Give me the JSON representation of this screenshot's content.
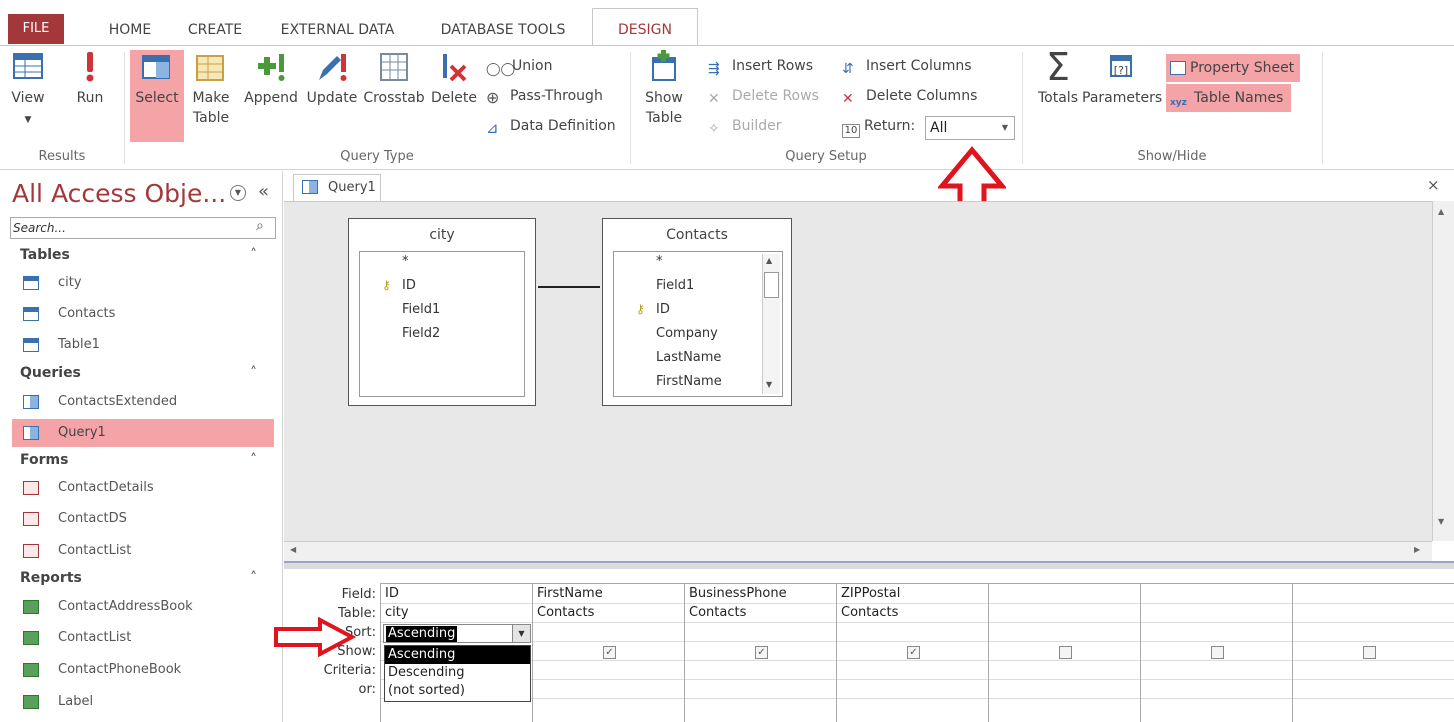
{
  "tabs": {
    "file": "FILE",
    "home": "HOME",
    "create": "CREATE",
    "external": "EXTERNAL DATA",
    "dbtools": "DATABASE TOOLS",
    "design": "DESIGN"
  },
  "ribbon": {
    "view": "View",
    "run": "Run",
    "select": "Select",
    "make_table_1": "Make",
    "make_table_2": "Table",
    "append": "Append",
    "update": "Update",
    "crosstab": "Crosstab",
    "delete": "Delete",
    "union": "Union",
    "passthrough": "Pass-Through",
    "data_definition": "Data Definition",
    "show_table_1": "Show",
    "show_table_2": "Table",
    "insert_rows": "Insert Rows",
    "delete_rows": "Delete Rows",
    "builder": "Builder",
    "insert_columns": "Insert Columns",
    "delete_columns": "Delete Columns",
    "return_label": "Return:",
    "return_value": "All",
    "totals": "Totals",
    "parameters": "Parameters",
    "property_sheet": "Property Sheet",
    "table_names": "Table Names",
    "groups": {
      "results": "Results",
      "query_type": "Query Type",
      "query_setup": "Query Setup",
      "show_hide": "Show/Hide"
    }
  },
  "nav": {
    "title": "All Access Obje...",
    "search_placeholder": "Search...",
    "sections": {
      "tables": "Tables",
      "queries": "Queries",
      "forms": "Forms",
      "reports": "Reports"
    },
    "tables": [
      "city",
      "Contacts",
      "Table1"
    ],
    "queries": [
      "ContactsExtended",
      "Query1"
    ],
    "forms": [
      "ContactDetails",
      "ContactDS",
      "ContactList"
    ],
    "reports": [
      "ContactAddressBook",
      "ContactList",
      "ContactPhoneBook",
      "Label"
    ]
  },
  "query_tab": "Query1",
  "tables": {
    "city": {
      "title": "city",
      "fields": [
        "*",
        "ID",
        "Field1",
        "Field2"
      ]
    },
    "contacts": {
      "title": "Contacts",
      "fields": [
        "*",
        "Field1",
        "ID",
        "Company",
        "LastName",
        "FirstName"
      ]
    }
  },
  "grid": {
    "row_labels": {
      "field": "Field:",
      "table": "Table:",
      "sort": "Sort:",
      "show": "Show:",
      "criteria": "Criteria:",
      "or": "or:"
    },
    "columns": [
      {
        "field": "ID",
        "table": "city",
        "sort": "Ascending"
      },
      {
        "field": "FirstName",
        "table": "Contacts",
        "show": true
      },
      {
        "field": "BusinessPhone",
        "table": "Contacts",
        "show": true
      },
      {
        "field": "ZIPPostal",
        "table": "Contacts",
        "show": true
      }
    ],
    "sort_options": [
      "Ascending",
      "Descending",
      "(not sorted)"
    ],
    "checkmark": "✓"
  },
  "colors": {
    "accent": "#a4373a",
    "highlight": "#f4a3a7",
    "arrow": "#e0141e"
  }
}
